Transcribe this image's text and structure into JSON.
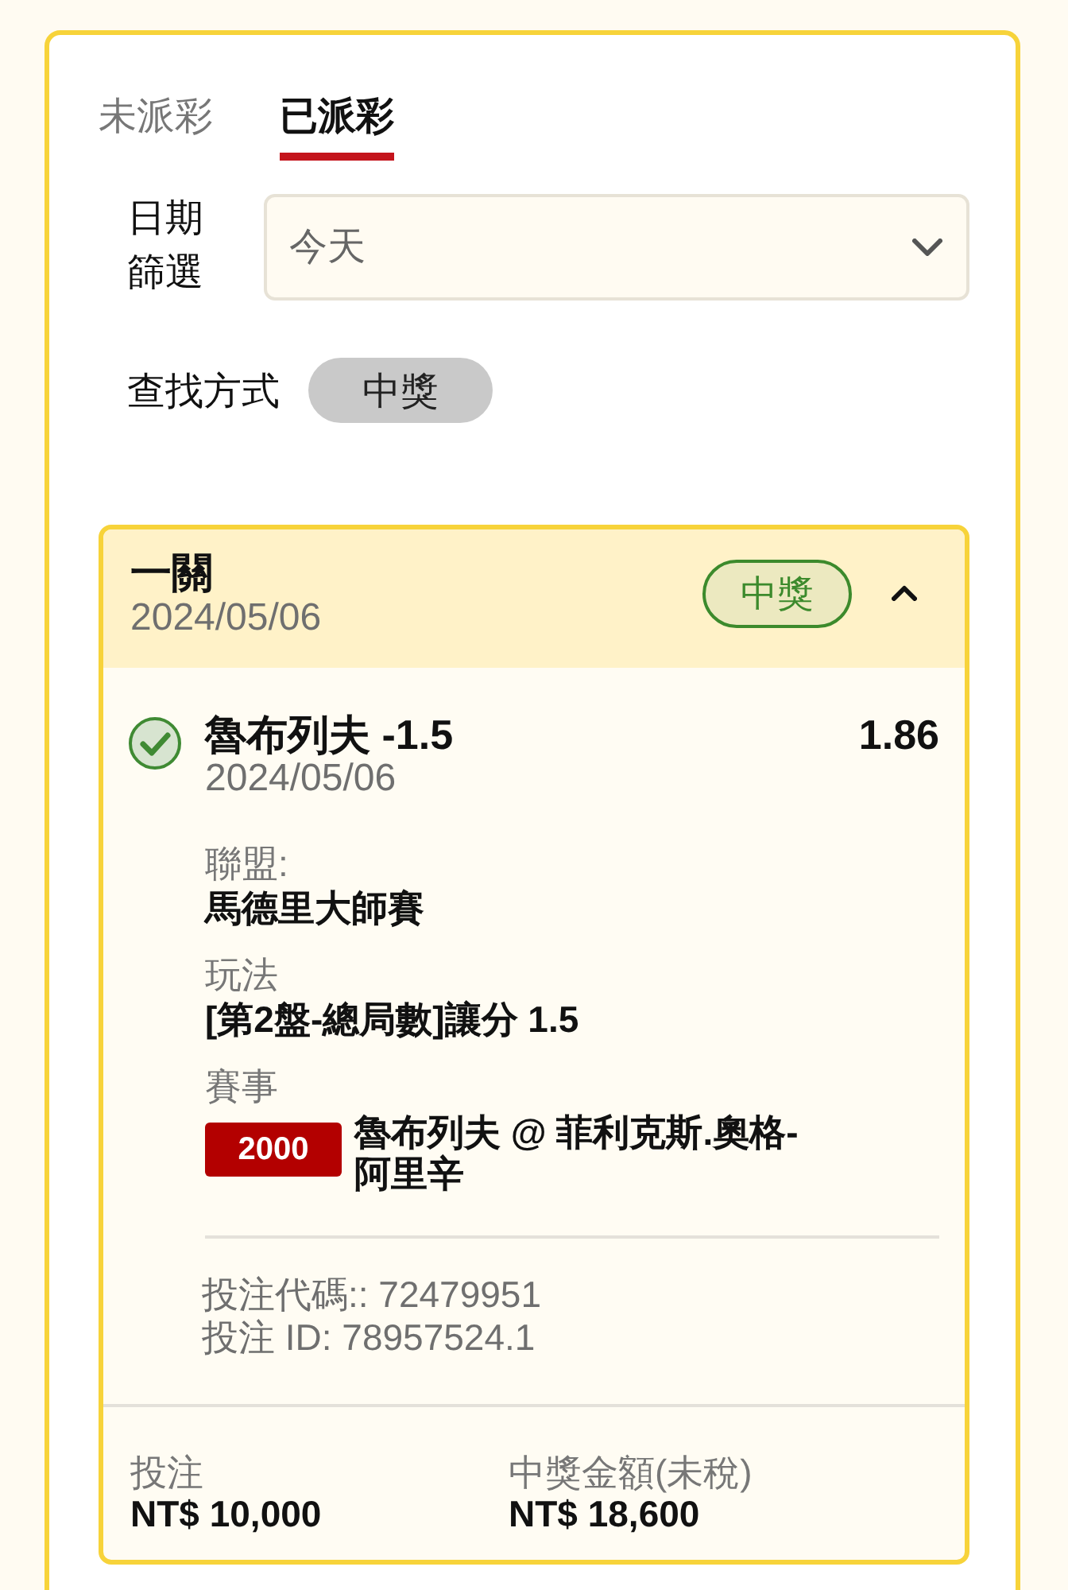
{
  "tabs": [
    {
      "label": "未派彩",
      "selected": false
    },
    {
      "label": "已派彩",
      "selected": true
    }
  ],
  "date_filter": {
    "label": "日期篩選",
    "value": "今天"
  },
  "search_mode": {
    "label": "查找方式",
    "chips": [
      {
        "label": "中獎",
        "selected": true
      }
    ]
  },
  "bet": {
    "type": "一關",
    "date": "2024/05/06",
    "status": {
      "label": "中獎",
      "kind": "won"
    },
    "expanded": true,
    "selection": {
      "name": "魯布列夫 -1.5",
      "date": "2024/05/06",
      "odds": "1.86",
      "won": true
    },
    "details": [
      {
        "label": "聯盟:",
        "value": "馬德里大師賽"
      },
      {
        "label": "玩法",
        "value": "[第2盤-總局數]讓分 1.5"
      },
      {
        "label": "賽事",
        "value": "魯布列夫 @ 菲利克斯.奧格-阿里辛",
        "tag": "2000"
      }
    ],
    "refs": [
      "投注代碼:: 72479951",
      "投注 ID: 78957524.1"
    ],
    "summary": [
      {
        "label": "投注",
        "value": "NT$ 10,000"
      },
      {
        "label": "中獎金額(未稅)",
        "value": "NT$ 18,600"
      }
    ]
  }
}
